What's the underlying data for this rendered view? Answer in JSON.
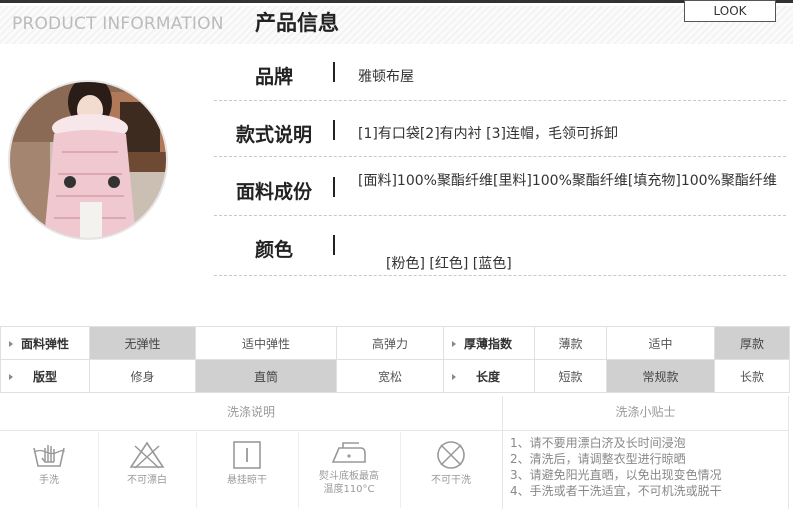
{
  "header": {
    "title_en": "PRODUCT INFORMATION",
    "title_cn": "产品信息",
    "look_button": "LOOK"
  },
  "product_rows": [
    {
      "label": "品牌",
      "value": "雅顿布屋"
    },
    {
      "label": "款式说明",
      "value": "[1]有口袋[2]有内衬 [3]连帽，毛领可拆卸"
    },
    {
      "label": "面料成份",
      "value": "[面料]100%聚酯纤维[里料]100%聚酯纤维[填充物]100%聚酯纤维"
    },
    {
      "label": "颜色",
      "value": "[粉色] [红色]  [蓝色]"
    }
  ],
  "attributes": [
    {
      "label": "面料弹性",
      "options": [
        "无弹性",
        "适中弹性",
        "高弹力"
      ],
      "selected": "无弹性"
    },
    {
      "label": "厚薄指数",
      "options": [
        "薄款",
        "适中",
        "厚款"
      ],
      "selected": "厚款"
    },
    {
      "label": "版型",
      "options": [
        "修身",
        "直筒",
        "宽松"
      ],
      "selected": "直筒"
    },
    {
      "label": "长度",
      "options": [
        "短款",
        "常规款",
        "长款"
      ],
      "selected": "常规款"
    }
  ],
  "care": {
    "instructions_title": "洗涤说明",
    "tips_title": "洗涤小贴士",
    "icons": [
      {
        "icon": "hand-wash-icon",
        "label": "手洗"
      },
      {
        "icon": "no-bleach-icon",
        "label": "不可漂白"
      },
      {
        "icon": "hang-dry-icon",
        "label": "悬挂晾干"
      },
      {
        "icon": "iron-icon",
        "label_line1": "熨斗底板最高",
        "label_line2": "温度110°C"
      },
      {
        "icon": "no-dry-clean-icon",
        "label": "不可干洗"
      }
    ],
    "tips": [
      "1、请不要用漂白济及长时间浸泡",
      "2、清洗后，请调整衣型进行晾晒",
      "3、请避免阳光直晒，以免出现变色情况",
      "4、手洗或者干洗适宜，不可机洗或脱干"
    ]
  },
  "colors": {
    "selected_bg": "#d0d0d0",
    "separator": "#c8c8c8",
    "icon_gray": "#999999"
  }
}
